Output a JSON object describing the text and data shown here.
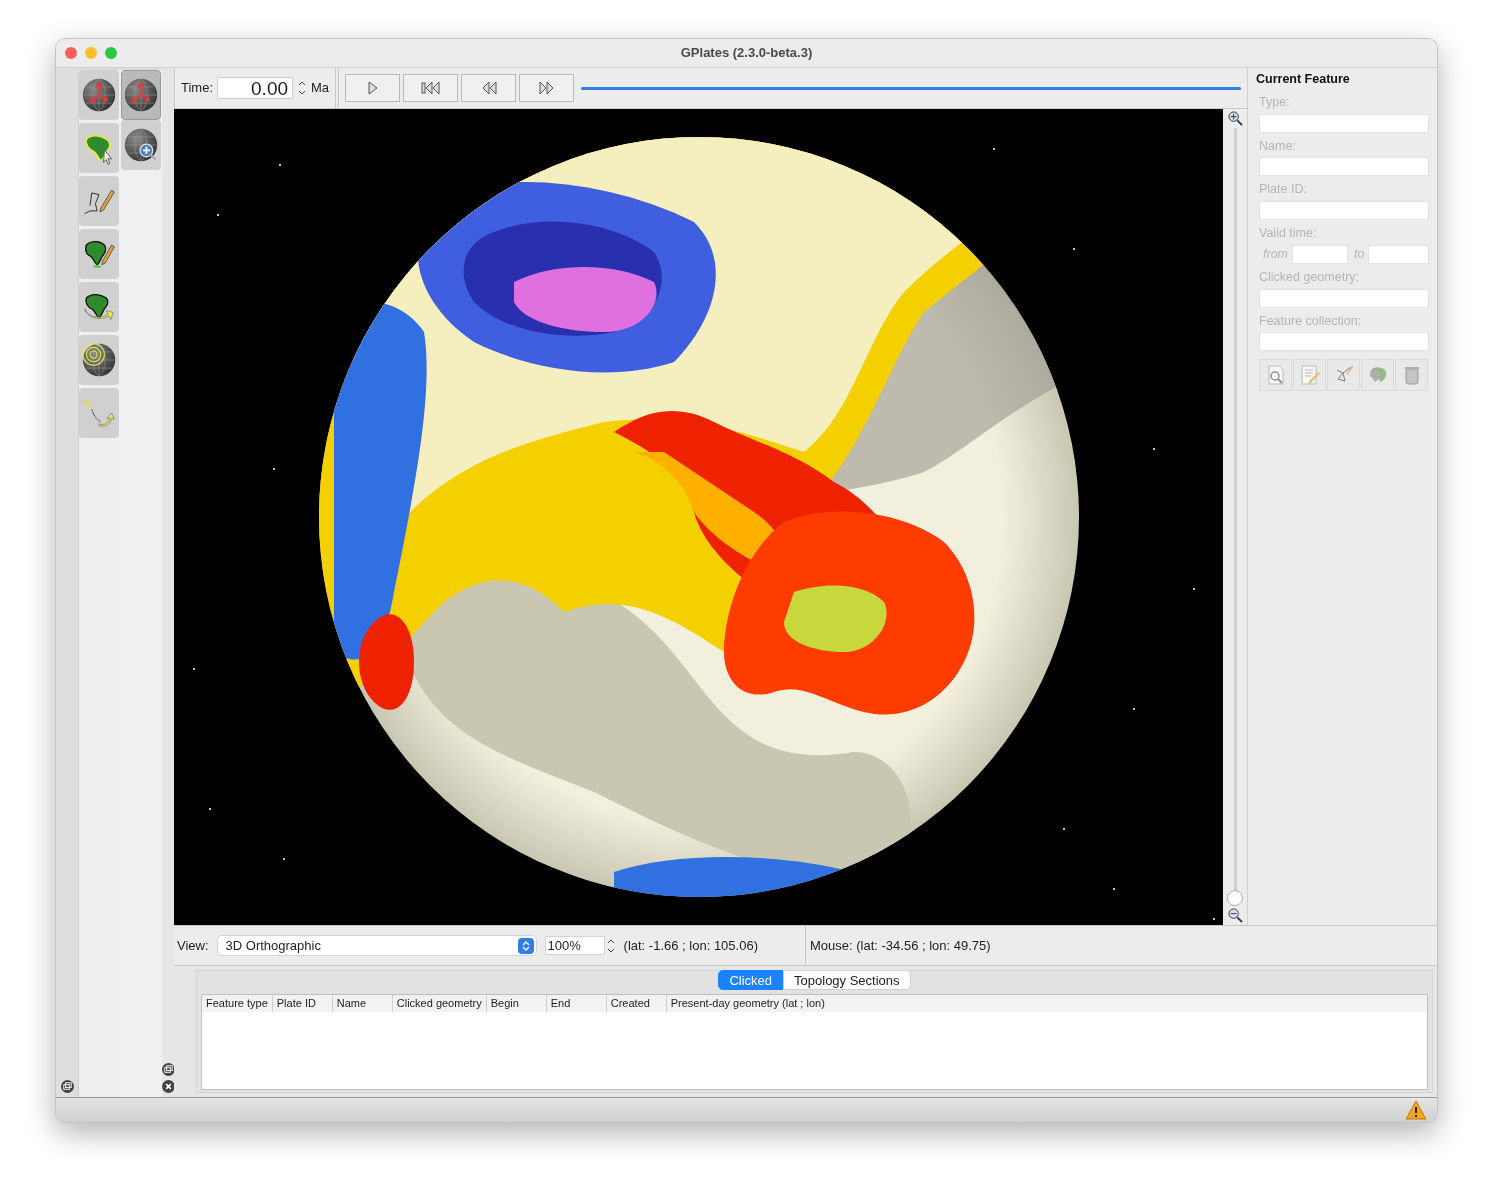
{
  "window": {
    "title": "GPlates (2.3.0-beta.3)"
  },
  "tool_palette": {
    "column_1": [
      {
        "kind": "drag-globe",
        "selected": false
      },
      {
        "kind": "choose-feature",
        "selected": false
      },
      {
        "kind": "digitise",
        "selected": false
      },
      {
        "kind": "edit-topology",
        "selected": false
      },
      {
        "kind": "reconstruct",
        "selected": false
      },
      {
        "kind": "small-circle",
        "selected": false
      },
      {
        "kind": "pole-manipulate",
        "selected": false
      }
    ],
    "column_2": [
      {
        "kind": "drag-globe",
        "selected": true
      },
      {
        "kind": "zoom-globe",
        "selected": false
      }
    ]
  },
  "toolbar": {
    "time_label": "Time:",
    "time_value": "0.00",
    "time_unit": "Ma",
    "animation_slider": {
      "level": 1.0
    }
  },
  "zoom_slider": {
    "level": 0.0
  },
  "current_feature": {
    "title": "Current Feature",
    "disabled": true,
    "fields": [
      {
        "label": "Type:"
      },
      {
        "label": "Name:"
      },
      {
        "label": "Plate ID:"
      }
    ],
    "valid_time": {
      "label": "Valid time:",
      "from": "from",
      "to": "to"
    },
    "fields_after": [
      {
        "label": "Clicked geometry:"
      },
      {
        "label": "Feature collection:"
      }
    ]
  },
  "view_bar": {
    "label": "View:",
    "projection": "3D Orthographic",
    "zoom": "100%",
    "camera": "(lat: -1.66 ; lon: 105.06)",
    "mouse": "Mouse: (lat: -34.56 ; lon: 49.75)"
  },
  "bottom_panel": {
    "tabs": [
      {
        "label": "Clicked",
        "selected": true
      },
      {
        "label": "Topology Sections",
        "selected": false
      }
    ],
    "columns": [
      "Feature type",
      "Plate ID",
      "Name",
      "Clicked geometry",
      "Begin",
      "End",
      "Created",
      "Present-day geometry (lat ; lon)"
    ]
  }
}
